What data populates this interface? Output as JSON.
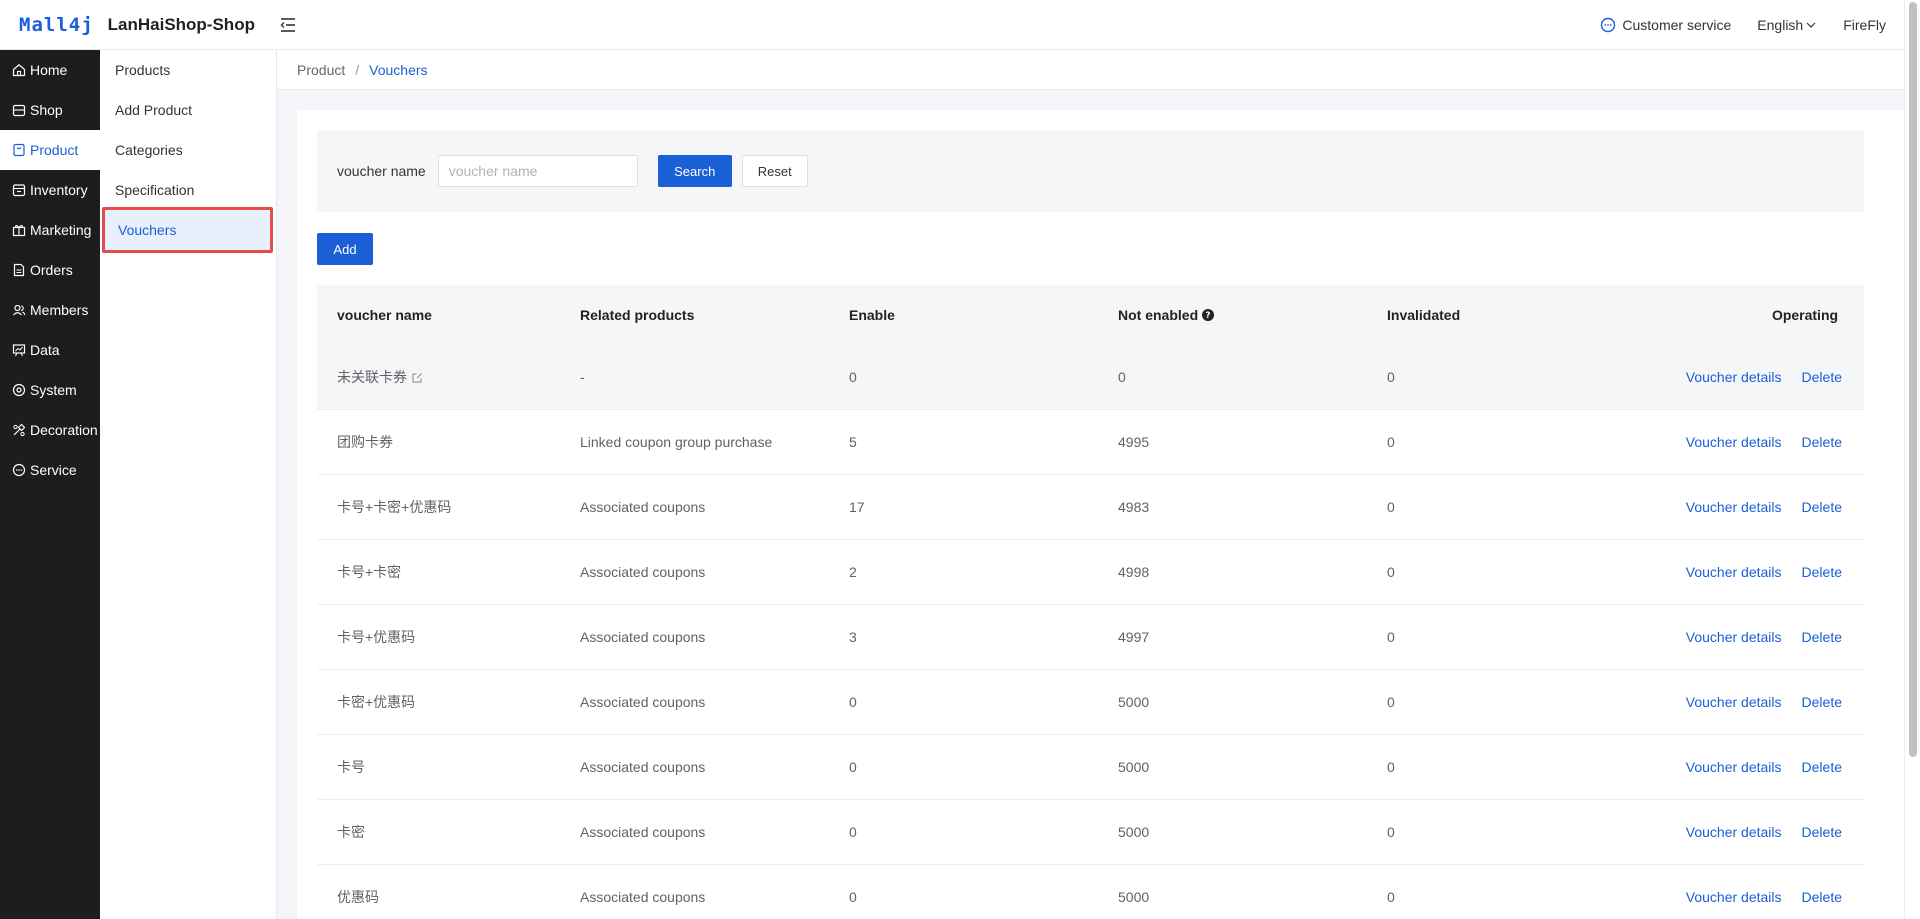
{
  "header": {
    "logo_mark": "Mall4j",
    "shop_title": "LanHaiShop-Shop",
    "customer_service": "Customer service",
    "language": "English",
    "user": "FireFly"
  },
  "sidebar": {
    "items": [
      {
        "label": "Home",
        "icon": "home-icon"
      },
      {
        "label": "Shop",
        "icon": "shop-icon"
      },
      {
        "label": "Product",
        "icon": "product-icon",
        "active": true
      },
      {
        "label": "Inventory",
        "icon": "inventory-icon"
      },
      {
        "label": "Marketing",
        "icon": "marketing-icon"
      },
      {
        "label": "Orders",
        "icon": "orders-icon"
      },
      {
        "label": "Members",
        "icon": "members-icon"
      },
      {
        "label": "Data",
        "icon": "data-icon"
      },
      {
        "label": "System",
        "icon": "system-icon"
      },
      {
        "label": "Decoration",
        "icon": "decoration-icon"
      },
      {
        "label": "Service",
        "icon": "service-icon"
      }
    ]
  },
  "submenu": {
    "items": [
      {
        "label": "Products"
      },
      {
        "label": "Add Product"
      },
      {
        "label": "Categories"
      },
      {
        "label": "Specification"
      },
      {
        "label": "Vouchers",
        "active": true
      }
    ]
  },
  "breadcrumb": {
    "parent": "Product",
    "separator": "/",
    "current": "Vouchers"
  },
  "search": {
    "label": "voucher name",
    "placeholder": "voucher name",
    "value": "",
    "search_button": "Search",
    "reset_button": "Reset"
  },
  "toolbar": {
    "add_button": "Add"
  },
  "table": {
    "columns": {
      "name": "voucher name",
      "related": "Related products",
      "enable": "Enable",
      "not_enabled": "Not enabled",
      "invalidated": "Invalidated",
      "operating": "Operating"
    },
    "actions": {
      "details": "Voucher details",
      "delete": "Delete"
    },
    "rows": [
      {
        "name": "未关联卡券",
        "related": "-",
        "enable": "0",
        "not_enabled": "0",
        "invalidated": "0"
      },
      {
        "name": "团购卡券",
        "related": "Linked coupon group purchase",
        "enable": "5",
        "not_enabled": "4995",
        "invalidated": "0"
      },
      {
        "name": "卡号+卡密+优惠码",
        "related": "Associated coupons",
        "enable": "17",
        "not_enabled": "4983",
        "invalidated": "0"
      },
      {
        "name": "卡号+卡密",
        "related": "Associated coupons",
        "enable": "2",
        "not_enabled": "4998",
        "invalidated": "0"
      },
      {
        "name": "卡号+优惠码",
        "related": "Associated coupons",
        "enable": "3",
        "not_enabled": "4997",
        "invalidated": "0"
      },
      {
        "name": "卡密+优惠码",
        "related": "Associated coupons",
        "enable": "0",
        "not_enabled": "5000",
        "invalidated": "0"
      },
      {
        "name": "卡号",
        "related": "Associated coupons",
        "enable": "0",
        "not_enabled": "5000",
        "invalidated": "0"
      },
      {
        "name": "卡密",
        "related": "Associated coupons",
        "enable": "0",
        "not_enabled": "5000",
        "invalidated": "0"
      },
      {
        "name": "优惠码",
        "related": "Associated coupons",
        "enable": "0",
        "not_enabled": "5000",
        "invalidated": "0"
      }
    ]
  },
  "colors": {
    "accent": "#1a5fd6",
    "sidebar_bg": "#1d1d1f",
    "highlight_border": "#e74c4c"
  }
}
